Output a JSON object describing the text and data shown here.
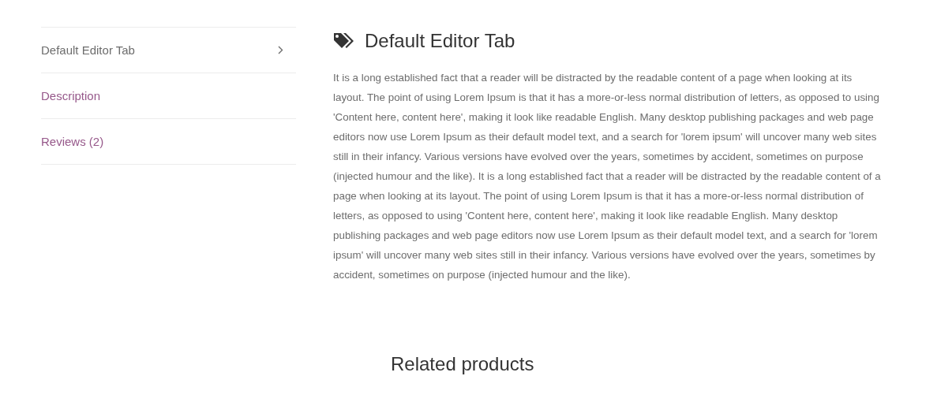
{
  "tabs": [
    {
      "label": "Default Editor Tab",
      "selected": true
    },
    {
      "label": "Description",
      "selected": false
    },
    {
      "label": "Reviews (2)",
      "selected": false
    }
  ],
  "panel": {
    "title": "Default Editor Tab",
    "text": "It is a long established fact that a reader will be distracted by the readable content of a page when looking at its layout. The point of using Lorem Ipsum is that it has a more-or-less normal distribution of letters, as opposed to using 'Content here, content here', making it look like readable English. Many desktop publishing packages and web page editors now use Lorem Ipsum as their default model text, and a search for 'lorem ipsum' will uncover many web sites still in their infancy. Various versions have evolved over the years, sometimes by accident, sometimes on purpose (injected humour and the like). It is a long established fact that a reader will be distracted by the readable content of a page when looking at its layout. The point of using Lorem Ipsum is that it has a more-or-less normal distribution of letters, as opposed to using 'Content here, content here', making it look like readable English. Many desktop publishing packages and web page editors now use Lorem Ipsum as their default model text, and a search for 'lorem ipsum' will uncover many web sites still in their infancy. Various versions have evolved over the years, sometimes by accident, sometimes on purpose (injected humour and the like)."
  },
  "related": {
    "title": "Related products"
  }
}
